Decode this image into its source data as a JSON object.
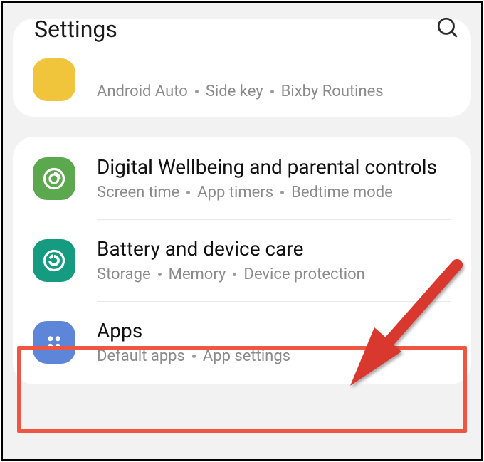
{
  "header": {
    "title": "Settings"
  },
  "group_prev": {
    "subtitle_parts": [
      "Android Auto",
      "Side key",
      "Bixby Routines"
    ]
  },
  "items": [
    {
      "title": "Digital Wellbeing and parental controls",
      "subtitle_parts": [
        "Screen time",
        "App timers",
        "Bedtime mode"
      ]
    },
    {
      "title": "Battery and device care",
      "subtitle_parts": [
        "Storage",
        "Memory",
        "Device protection"
      ]
    },
    {
      "title": "Apps",
      "subtitle_parts": [
        "Default apps",
        "App settings"
      ]
    }
  ]
}
